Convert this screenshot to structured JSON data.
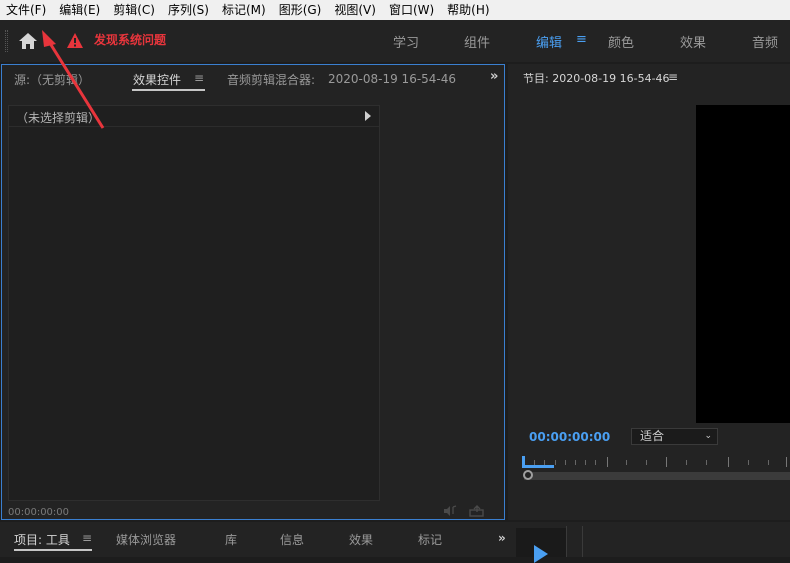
{
  "menubar": {
    "items": [
      "文件(F)",
      "编辑(E)",
      "剪辑(C)",
      "序列(S)",
      "标记(M)",
      "图形(G)",
      "视图(V)",
      "窗口(W)",
      "帮助(H)"
    ]
  },
  "workspace": {
    "warning_text": "发现系统问题",
    "tabs": [
      "学习",
      "组件",
      "编辑",
      "颜色",
      "效果",
      "音频"
    ],
    "active_tab": "编辑",
    "menu_glyph": "≡"
  },
  "left_panel": {
    "tab_source": "源:（无剪辑）",
    "tab_effects": "效果控件",
    "tab_effects_menu": "≡",
    "tab_audio_mixer": "音频剪辑混合器:",
    "tab_audio_mixer_date": "2020-08-19 16-54-46",
    "overflow": "»",
    "no_clip_label": "（未选择剪辑）",
    "timecode": "00:00:00:00"
  },
  "right_panel": {
    "title": "节目: 2020-08-19 16-54-46",
    "menu_glyph": "≡",
    "timecode": "00:00:00:00",
    "fit_option": "适合",
    "fit_chevron": "⌄"
  },
  "bottom_panel": {
    "tabs": [
      "项目: 工具",
      "媒体浏览器",
      "库",
      "信息",
      "效果",
      "标记"
    ],
    "active_menu": "≡",
    "overflow": "»"
  },
  "colors": {
    "accent": "#4a9ff2",
    "warning": "#e8353c",
    "annotation_arrow": "#e8353c"
  },
  "icons": [
    "home-icon",
    "warning-icon",
    "audio-toggle-icon",
    "export-frame-icon",
    "play-icon",
    "annotation-arrow"
  ]
}
